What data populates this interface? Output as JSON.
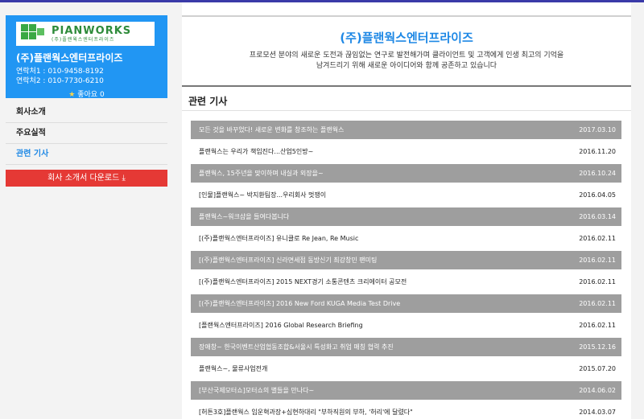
{
  "company": {
    "logo_main": "PIANWORKS",
    "logo_sub": "(주)플랜웍스엔터프라이즈",
    "name": "(주)플랜웍스엔터프라이즈",
    "contact1": "연락처1 : 010-9458-8192",
    "contact2": "연락처2 : 010-7730-6210",
    "likes": "좋아요 0"
  },
  "menu": [
    {
      "label": "회사소개",
      "active": false
    },
    {
      "label": "주요실적",
      "active": false
    },
    {
      "label": "관련 기사",
      "active": true
    }
  ],
  "download_label": "회사 소개서 다운로드 ⤓",
  "main": {
    "title": "(주)플랜웍스엔터프라이즈",
    "desc_line1": "프로모션 분야의 새로운 도전과 끊임없는 연구로 발전해가며 클라이언트 및 고객에게 인생 최고의 기억을",
    "desc_line2": "남겨드리기 위해 새로운 아이디어와 함께 공존하고 있습니다",
    "section_title": "관련 기사"
  },
  "articles": [
    {
      "title": "모든 것을 바꾸었다! 새로운 변화를 창조하는 플랜웍스",
      "date": "2017.03.10",
      "shaded": true
    },
    {
      "title": "플랜웍스는 우리가 책임진다...산업5인방~",
      "date": "2016.11.20",
      "shaded": false
    },
    {
      "title": "플랜웍스, 15주년을 맞이하며 내실과 외장을~",
      "date": "2016.10.24",
      "shaded": true
    },
    {
      "title": "[인물]플랜웍스~ 박지환팀장...우리회사 멋쟁이",
      "date": "2016.04.05",
      "shaded": false
    },
    {
      "title": "플랜웍스~워크샵을 들여다봅니다",
      "date": "2016.03.14",
      "shaded": true
    },
    {
      "title": "[(주)플랜웍스엔터프라이즈] 유니클로 Re Jean, Re Music",
      "date": "2016.02.11",
      "shaded": false
    },
    {
      "title": "[(주)플랜웍스엔터프라이즈] 신라면세점 동방신기 최강창민 팬미팅",
      "date": "2016.02.11",
      "shaded": true
    },
    {
      "title": "[(주)플랜웍스엔터프라이즈] 2015 NEXT경기 소통콘텐츠 크리에이터 공모전",
      "date": "2016.02.11",
      "shaded": false
    },
    {
      "title": "[(주)플랜웍스엔터프라이즈] 2016 New Ford KUGA Media Test Drive",
      "date": "2016.02.11",
      "shaded": true
    },
    {
      "title": "[플랜웍스엔터프라이즈] 2016 Global Research Briefing",
      "date": "2016.02.11",
      "shaded": false
    },
    {
      "title": "장애창~ 한국이벤트산업협동조합&서울시 특성화고 취업 매칭 협력 추진",
      "date": "2015.12.16",
      "shaded": true
    },
    {
      "title": "플랜웍스~, 물류사업전개",
      "date": "2015.07.20",
      "shaded": false
    },
    {
      "title": "[부산국제모터쇼]모터쇼의 별들을 만나다~",
      "date": "2014.06.02",
      "shaded": true
    },
    {
      "title": "[허튼3호]플랜웍스 임운혁과장+심현하대리 \"부하직원의 부하, '허리'에 달렸다\"",
      "date": "2014.03.07",
      "shaded": false
    }
  ],
  "colors": {
    "accent": "#2196f3",
    "download": "#e53935",
    "active_menu": "#1e88e5",
    "shaded_row": "#9e9e9e",
    "logo_green": "#2e8b3a"
  }
}
